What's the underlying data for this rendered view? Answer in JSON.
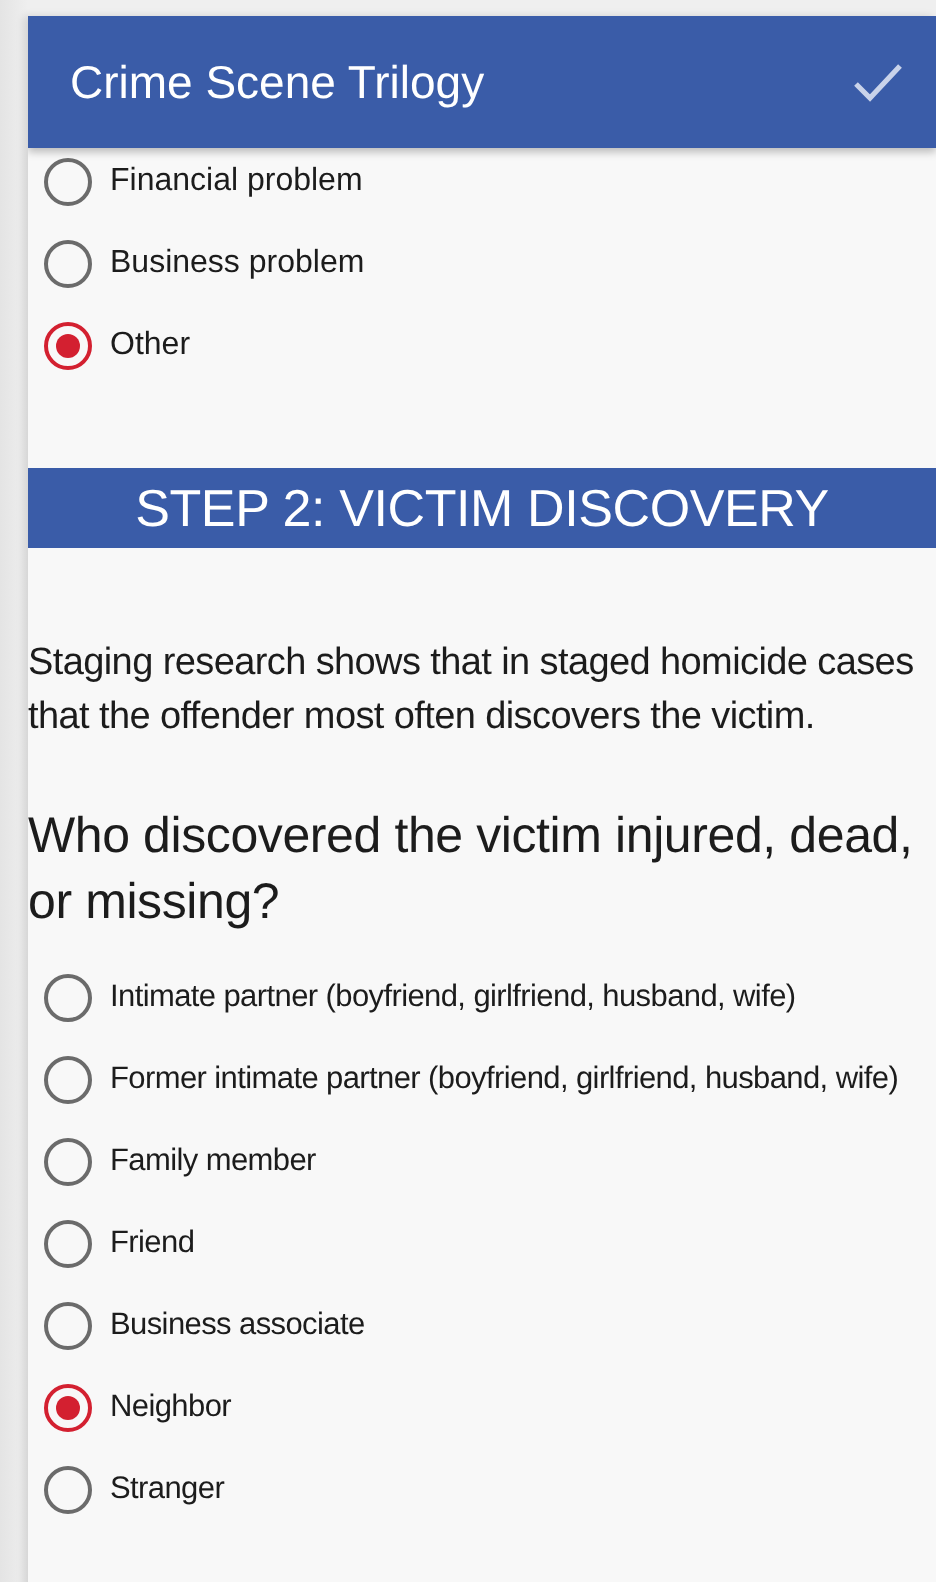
{
  "app_bar": {
    "title": "Crime Scene Trilogy"
  },
  "previous_options": [
    {
      "label": "Financial problem",
      "selected": false
    },
    {
      "label": "Business problem",
      "selected": false
    },
    {
      "label": "Other",
      "selected": true
    }
  ],
  "step_header": "STEP 2: VICTIM DISCOVERY",
  "intro": "Staging research shows that in staged homicide cases that the offender most often discovers the victim.",
  "question": "Who discovered the victim injured, dead, or missing?",
  "options": [
    {
      "label": "Intimate partner (boyfriend, girlfriend, husband, wife)",
      "selected": false
    },
    {
      "label": "Former intimate partner (boyfriend, girlfriend, husband, wife)",
      "selected": false
    },
    {
      "label": "Family member",
      "selected": false
    },
    {
      "label": "Friend",
      "selected": false
    },
    {
      "label": "Business associate",
      "selected": false
    },
    {
      "label": "Neighbor",
      "selected": true
    },
    {
      "label": "Stranger",
      "selected": false
    }
  ]
}
